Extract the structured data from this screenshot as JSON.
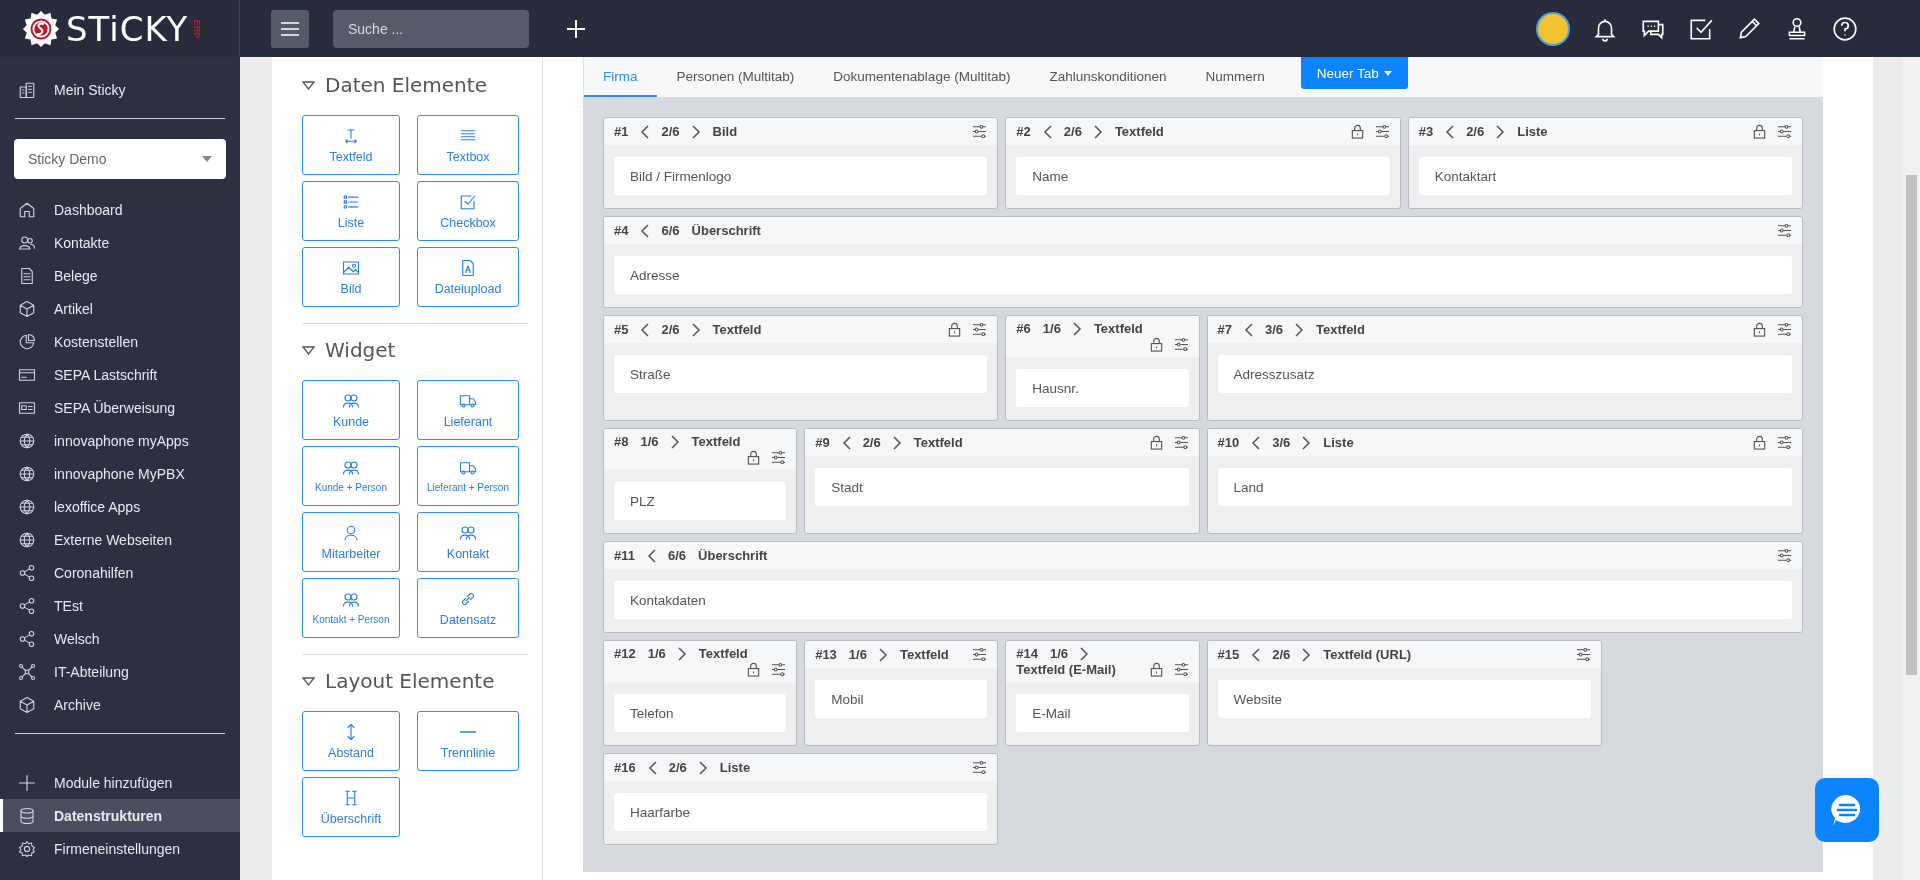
{
  "topbar": {
    "logo": "STiCKY",
    "logo_suffix": "ERP",
    "search_placeholder": "Suche ..."
  },
  "sidebar": {
    "home": "Mein Sticky",
    "company_select": "Sticky Demo",
    "items": [
      {
        "label": "Dashboard",
        "kind": "home",
        "selected": false
      },
      {
        "label": "Kontakte",
        "kind": "contacts",
        "selected": false
      },
      {
        "label": "Belege",
        "kind": "document",
        "selected": false
      },
      {
        "label": "Artikel",
        "kind": "box",
        "selected": false
      },
      {
        "label": "Kostenstellen",
        "kind": "pie",
        "selected": false
      },
      {
        "label": "SEPA Lastschrift",
        "kind": "card",
        "selected": false
      },
      {
        "label": "SEPA Überweisung",
        "kind": "idcard",
        "selected": false
      },
      {
        "label": "innovaphone myApps",
        "kind": "globe",
        "selected": false
      },
      {
        "label": "innovaphone MyPBX",
        "kind": "globe",
        "selected": false
      },
      {
        "label": "lexoffice Apps",
        "kind": "globe",
        "selected": false
      },
      {
        "label": "Externe Webseiten",
        "kind": "globe",
        "selected": false
      },
      {
        "label": "Coronahilfen",
        "kind": "share",
        "selected": false
      },
      {
        "label": "TEst",
        "kind": "share",
        "selected": false
      },
      {
        "label": "Welsch",
        "kind": "share",
        "selected": false
      },
      {
        "label": "IT-Abteilung",
        "kind": "network",
        "selected": false
      },
      {
        "label": "Archive",
        "kind": "box",
        "selected": false
      }
    ],
    "bottom_items": [
      {
        "label": "Module hinzufügen",
        "kind": "plus",
        "selected": false
      },
      {
        "label": "Datenstrukturen",
        "kind": "database",
        "selected": true
      },
      {
        "label": "Firmeneinstellungen",
        "kind": "gear",
        "selected": false
      }
    ]
  },
  "palette": {
    "sections": [
      {
        "title": "Daten Elemente",
        "items": [
          {
            "label": "Textfeld",
            "kind": "textfield",
            "compact": false
          },
          {
            "label": "Textbox",
            "kind": "textbox",
            "compact": false
          },
          {
            "label": "Liste",
            "kind": "list",
            "compact": false
          },
          {
            "label": "Checkbox",
            "kind": "checkbox",
            "compact": false
          },
          {
            "label": "Bild",
            "kind": "image",
            "compact": false
          },
          {
            "label": "Dateiupload",
            "kind": "file",
            "compact": false
          }
        ]
      },
      {
        "title": "Widget",
        "items": [
          {
            "label": "Kunde",
            "kind": "users",
            "compact": false
          },
          {
            "label": "Lieferant",
            "kind": "truck",
            "compact": false
          },
          {
            "label": "Kunde + Person",
            "kind": "users",
            "compact": true
          },
          {
            "label": "Lieferant + Person",
            "kind": "truck",
            "compact": true
          },
          {
            "label": "Mitarbeiter",
            "kind": "user",
            "compact": false
          },
          {
            "label": "Kontakt",
            "kind": "users",
            "compact": false
          },
          {
            "label": "Kontakt + Person",
            "kind": "users",
            "compact": true
          },
          {
            "label": "Datensatz",
            "kind": "link",
            "compact": false
          }
        ]
      },
      {
        "title": "Layout Elemente",
        "items": [
          {
            "label": "Abstand",
            "kind": "spacing",
            "compact": false
          },
          {
            "label": "Trennlinie",
            "kind": "divider",
            "compact": false
          },
          {
            "label": "Überschrift",
            "kind": "heading",
            "compact": false
          }
        ]
      }
    ]
  },
  "editor": {
    "tabs": [
      {
        "label": "Firma",
        "selected": true
      },
      {
        "label": "Personen (Multitab)",
        "selected": false
      },
      {
        "label": "Dokumentenablage (Multitab)",
        "selected": false
      },
      {
        "label": "Zahlunskonditionen",
        "selected": false
      },
      {
        "label": "Nummern",
        "selected": false
      }
    ],
    "new_tab_button": "Neuer Tab",
    "cards": [
      {
        "number": "#1",
        "size": "2/6",
        "type": "Bild",
        "locked": false,
        "label": "Bild / Firmenlogo"
      },
      {
        "number": "#2",
        "size": "2/6",
        "type": "Textfeld",
        "locked": true,
        "label": "Name"
      },
      {
        "number": "#3",
        "size": "2/6",
        "type": "Liste",
        "locked": true,
        "label": "Kontaktart"
      },
      {
        "number": "#4",
        "size": "6/6",
        "type": "Überschrift",
        "locked": false,
        "label": "Adresse"
      },
      {
        "number": "#5",
        "size": "2/6",
        "type": "Textfeld",
        "locked": true,
        "label": "Straße"
      },
      {
        "number": "#6",
        "size": "1/6",
        "type": "Textfeld",
        "locked": true,
        "label": "Hausnr."
      },
      {
        "number": "#7",
        "size": "3/6",
        "type": "Textfeld",
        "locked": true,
        "label": "Adresszusatz"
      },
      {
        "number": "#8",
        "size": "1/6",
        "type": "Textfeld",
        "locked": true,
        "label": "PLZ"
      },
      {
        "number": "#9",
        "size": "2/6",
        "type": "Textfeld",
        "locked": true,
        "label": "Stadt"
      },
      {
        "number": "#10",
        "size": "3/6",
        "type": "Liste",
        "locked": true,
        "label": "Land"
      },
      {
        "number": "#11",
        "size": "6/6",
        "type": "Überschrift",
        "locked": false,
        "label": "Kontakdaten"
      },
      {
        "number": "#12",
        "size": "1/6",
        "type": "Textfeld",
        "locked": true,
        "label": "Telefon"
      },
      {
        "number": "#13",
        "size": "1/6",
        "type": "Textfeld",
        "locked": false,
        "label": "Mobil"
      },
      {
        "number": "#14",
        "size": "1/6",
        "type": "Textfeld (E-Mail)",
        "locked": true,
        "label": "E-Mail"
      },
      {
        "number": "#15",
        "size": "2/6",
        "type": "Textfeld (URL)",
        "locked": false,
        "label": "Website"
      },
      {
        "number": "#16",
        "size": "2/6",
        "type": "Liste",
        "locked": false,
        "label": "Haarfarbe"
      }
    ]
  }
}
